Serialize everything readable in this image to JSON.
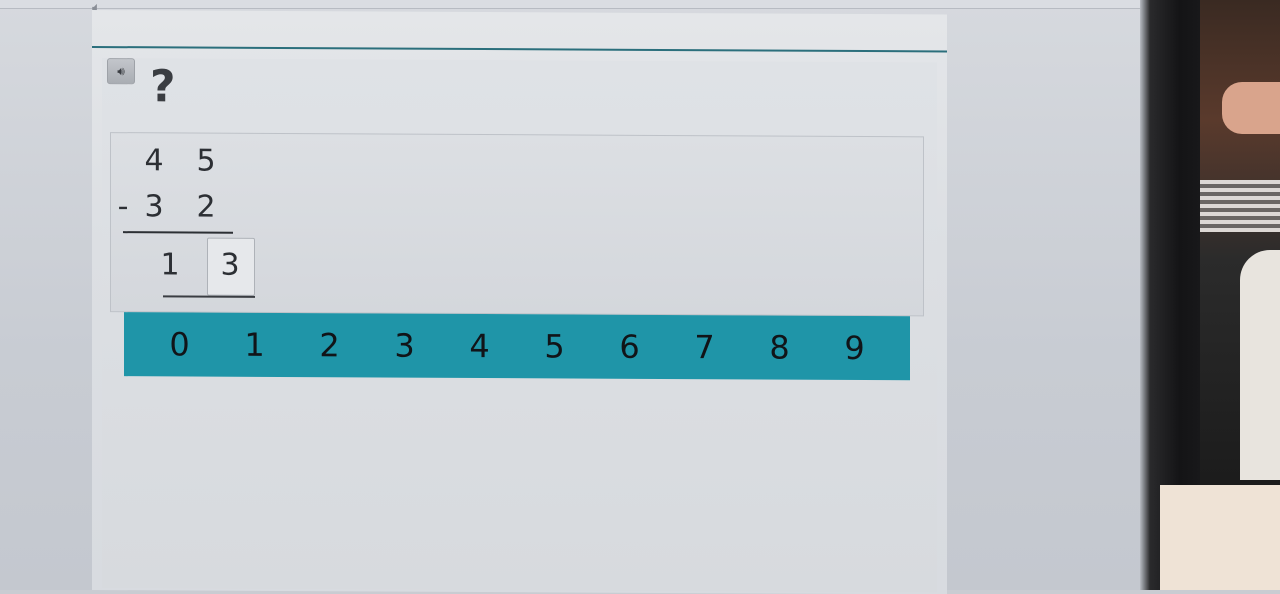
{
  "question": {
    "mark": "?"
  },
  "problem": {
    "top": [
      "4",
      "5"
    ],
    "operator": "-",
    "bottom": [
      "3",
      "2"
    ],
    "answer": [
      "1",
      "3"
    ]
  },
  "keypad": {
    "digits": [
      "0",
      "1",
      "2",
      "3",
      "4",
      "5",
      "6",
      "7",
      "8",
      "9"
    ]
  },
  "icons": {
    "top_speaker": "speaker-icon",
    "question_speaker": "speaker-icon"
  },
  "colors": {
    "keypad_bg": "#1f95a8",
    "rule": "#2b6f7c"
  }
}
